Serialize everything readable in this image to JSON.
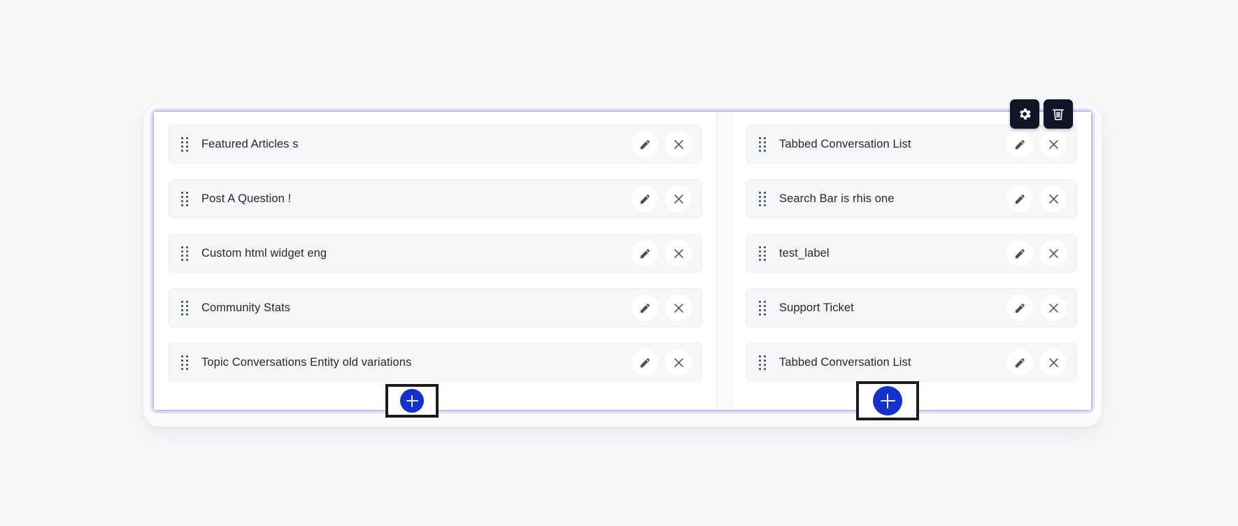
{
  "toolbar": {
    "settings_label": "Settings",
    "settings_icon": "gear-icon",
    "delete_label": "Delete",
    "delete_icon": "trash-icon"
  },
  "colors": {
    "page_background": "#f6f7f9",
    "panel_background": "#ffffff",
    "row_background": "#f6f7f9",
    "frame_border": "#b9c0f5",
    "accent_blue": "#1331ce",
    "toolbar_dark": "#101425",
    "focus_outline": "#1c1c1c"
  },
  "columns": [
    {
      "name": "left-column",
      "rows": [
        {
          "label": "Featured Articles s",
          "edit_icon": "pencil-icon",
          "remove_icon": "close-icon"
        },
        {
          "label": "Post A Question !",
          "edit_icon": "pencil-icon",
          "remove_icon": "close-icon"
        },
        {
          "label": "Custom html widget eng",
          "edit_icon": "pencil-icon",
          "remove_icon": "close-icon"
        },
        {
          "label": "Community Stats",
          "edit_icon": "pencil-icon",
          "remove_icon": "close-icon"
        },
        {
          "label": "Topic Conversations Entity old variations",
          "edit_icon": "pencil-icon",
          "remove_icon": "close-icon"
        }
      ],
      "add_button": {
        "label": "+",
        "icon": "plus-icon",
        "focused": true
      }
    },
    {
      "name": "right-column",
      "rows": [
        {
          "label": "Tabbed Conversation List",
          "edit_icon": "pencil-icon",
          "remove_icon": "close-icon"
        },
        {
          "label": "Search Bar is rhis one",
          "edit_icon": "pencil-icon",
          "remove_icon": "close-icon"
        },
        {
          "label": "test_label",
          "edit_icon": "pencil-icon",
          "remove_icon": "close-icon"
        },
        {
          "label": "Support Ticket",
          "edit_icon": "pencil-icon",
          "remove_icon": "close-icon"
        },
        {
          "label": "Tabbed Conversation List",
          "edit_icon": "pencil-icon",
          "remove_icon": "close-icon"
        }
      ],
      "add_button": {
        "label": "+",
        "icon": "plus-icon",
        "focused": true
      }
    }
  ]
}
